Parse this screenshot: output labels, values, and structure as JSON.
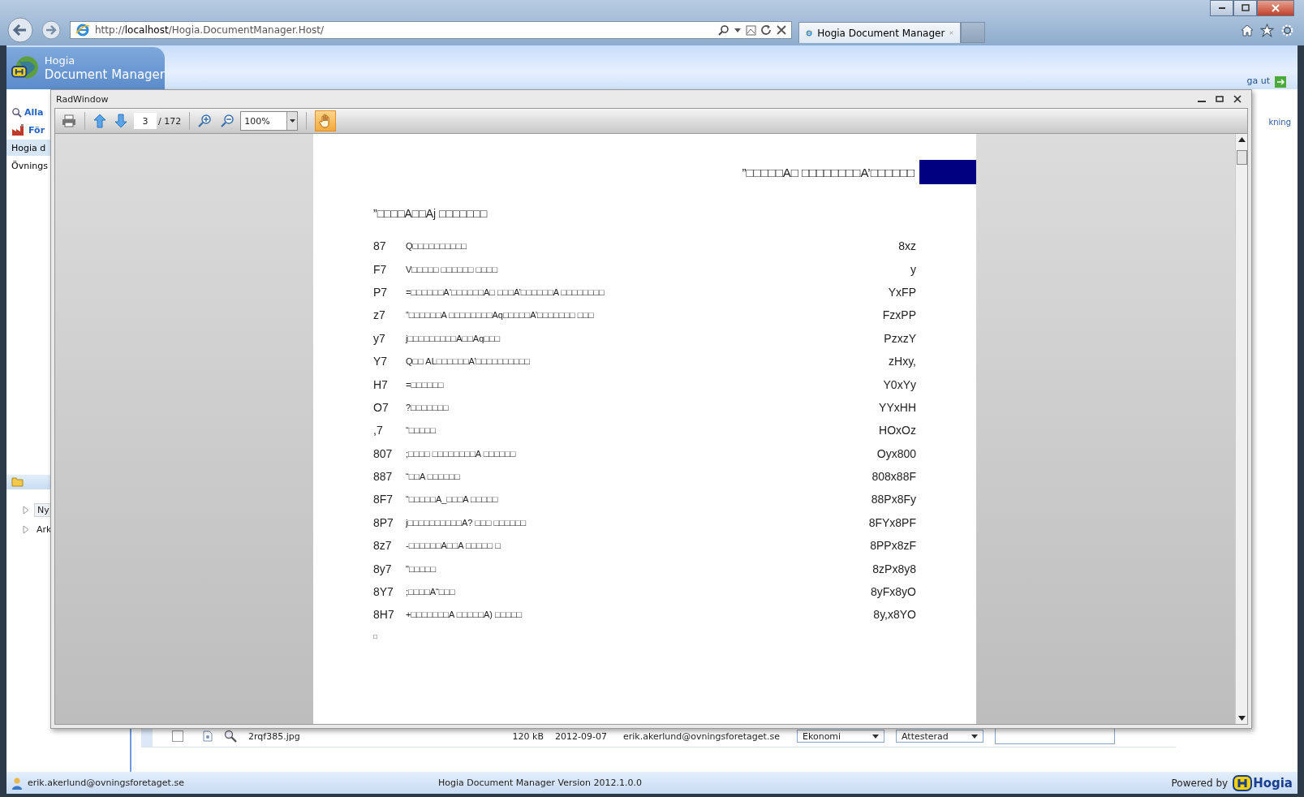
{
  "browser": {
    "address": "http://**localhost**/Hogia.DocumentManager.Host/",
    "tab": "Hogia Document Manager"
  },
  "app": {
    "brand": "Hogia",
    "product": "Document Manager",
    "logout": "ga ut",
    "side_link": "kning"
  },
  "sidebar": {
    "items": [
      {
        "label": "Alla",
        "kind": "search",
        "selected": false
      },
      {
        "label": "För",
        "kind": "company",
        "selected": false
      },
      {
        "label": "Hogia d",
        "kind": "plain",
        "selected": true
      },
      {
        "label": "Övnings",
        "kind": "plain",
        "selected": false
      }
    ],
    "tree": [
      {
        "label": "Ny",
        "selected": true
      },
      {
        "label": "Ark",
        "selected": false
      }
    ]
  },
  "radwindow": {
    "title": "RadWindow",
    "page": "3",
    "total": "/ 172",
    "zoom": "100%",
    "pan_active": true
  },
  "document": {
    "header": "”□□□□□A□ □□□□□□□□A’□□□□□□",
    "heading": "”□□□□A□□Aj □□□□□□□",
    "rows": [
      {
        "num": "87",
        "text": "Q□□□□□□□□□□",
        "amount": "8xz"
      },
      {
        "num": "F7",
        "text": "V□□□□□ □□□□□□ □□□□",
        "amount": "y"
      },
      {
        "num": "P7",
        "text": "=□□□□□□A‘□□□□□□A□ □□□A’□□□□□□A □□□□□□□□",
        "amount": "YxFP"
      },
      {
        "num": "z7",
        "text": "”□□□□□□A □□□□□□□□Aq□□□□□A’□□□□□□□ □□□",
        "amount": "FzxPP"
      },
      {
        "num": "y7",
        "text": "j□□□□□□□□□A□□Aq□□□",
        "amount": "PzxzY"
      },
      {
        "num": "Y7",
        "text": "Q□□ AL□□□□□□A’□□□□□□□□□□",
        "amount": "zHxy,"
      },
      {
        "num": "H7",
        "text": "=□□□□□□",
        "amount": "Y0xYy"
      },
      {
        "num": "O7",
        "text": "?□□□□□□□",
        "amount": "YYxHH"
      },
      {
        "num": ",7",
        "text": "“□□□□□",
        "amount": "HOxOz"
      },
      {
        "num": "807",
        "text": ";□□□□ □□□□□□□□A □□□□□□",
        "amount": "Oyx800"
      },
      {
        "num": "887",
        "text": "“□□A □□□□□□",
        "amount": "808x88F"
      },
      {
        "num": "8F7",
        "text": "“□□□□□A_□□□A □□□□□",
        "amount": "88Px8Fy"
      },
      {
        "num": "8P7",
        "text": "j□□□□□□□□□□A? □□□ □□□□□□",
        "amount": "8FYx8PF"
      },
      {
        "num": "8z7",
        "text": "-□□□□□□A□□A □□□□□ □",
        "amount": "8PPx8zF"
      },
      {
        "num": "8y7",
        "text": "\"□□□□□",
        "amount": "8zPx8y8"
      },
      {
        "num": "8Y7",
        "text": ";□□□□A“□□□",
        "amount": "8yFx8yO"
      },
      {
        "num": "8H7",
        "text": "+□□□□□□□A □□□□□A) □□□□□",
        "amount": "8y,x8YO"
      }
    ],
    "footer_mark": "□"
  },
  "grid": {
    "rows": [
      {
        "checked": false,
        "file": "2rqf385.jpg",
        "size": "120 kB",
        "date": "2012-09-07",
        "user": "erik.akerlund@ovningsforetaget.se",
        "category": "Ekonomi",
        "status": "Attesterad"
      }
    ]
  },
  "status_bar": {
    "user": "erik.akerlund@ovningsforetaget.se",
    "version": "Hogia Document Manager Version 2012.1.0.0",
    "powered": "Powered by",
    "logo": "Hogia"
  }
}
